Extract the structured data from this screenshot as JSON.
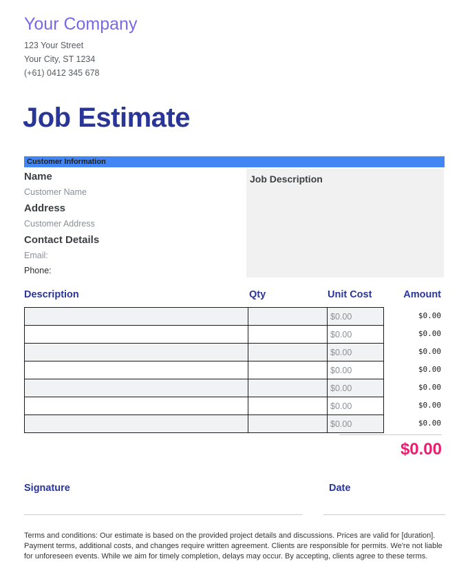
{
  "company": {
    "name": "Your Company",
    "street": "123 Your Street",
    "city_state_zip": "Your City, ST 1234",
    "phone": "(+61) 0412 345 678"
  },
  "document": {
    "title": "Job Estimate"
  },
  "customer_section": {
    "band_label": "Customer Information",
    "name_label": "Name",
    "name_value": "Customer Name",
    "address_label": "Address",
    "address_value": "Customer Address",
    "contact_label": "Contact Details",
    "email_label": "Email:",
    "phone_label": "Phone:"
  },
  "job_description": {
    "title": "Job Description",
    "body": ""
  },
  "items_table": {
    "columns": [
      "Description",
      "Qty",
      "Unit Cost",
      "Amount"
    ],
    "rows": [
      {
        "description": "",
        "qty": "",
        "unit_cost": "$0.00",
        "amount": "$0.00"
      },
      {
        "description": "",
        "qty": "",
        "unit_cost": "$0.00",
        "amount": "$0.00"
      },
      {
        "description": "",
        "qty": "",
        "unit_cost": "$0.00",
        "amount": "$0.00"
      },
      {
        "description": "",
        "qty": "",
        "unit_cost": "$0.00",
        "amount": "$0.00"
      },
      {
        "description": "",
        "qty": "",
        "unit_cost": "$0.00",
        "amount": "$0.00"
      },
      {
        "description": "",
        "qty": "",
        "unit_cost": "$0.00",
        "amount": "$0.00"
      },
      {
        "description": "",
        "qty": "",
        "unit_cost": "$0.00",
        "amount": "$0.00"
      }
    ],
    "grand_total": "$0.00"
  },
  "footer": {
    "signature_label": "Signature",
    "date_label": "Date",
    "terms": "Terms and conditions: Our estimate is based on the provided project details and discussions. Prices are valid for [duration]. Payment terms, additional costs, and changes require written agreement. Clients are responsible for permits. We're not liable for unforeseen events. While we aim for timely completion, delays may occur. By accepting, clients agree to these terms."
  },
  "colors": {
    "brand_purple": "#7668E8",
    "title_navy": "#2A3598",
    "band_blue": "#4285F4",
    "total_pink": "#EC1C70",
    "panel_gray": "#f1f1f1"
  }
}
